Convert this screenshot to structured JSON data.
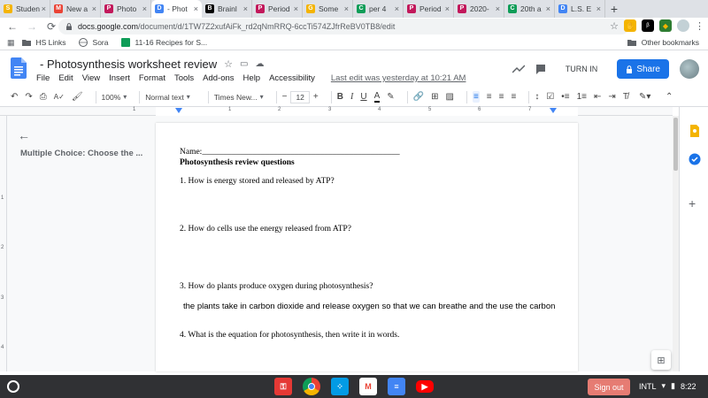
{
  "browser": {
    "tabs": [
      {
        "label": "Studen",
        "icon_color": "#f4b400",
        "icon_char": "S"
      },
      {
        "label": "New a",
        "icon_color": "#ea4335",
        "icon_char": "M"
      },
      {
        "label": "Photo",
        "icon_color": "#c2185b",
        "icon_char": "P"
      },
      {
        "label": "- Phot",
        "icon_color": "#4285f4",
        "icon_char": "D",
        "active": true
      },
      {
        "label": "Brainl",
        "icon_color": "#000000",
        "icon_char": "B"
      },
      {
        "label": "Period",
        "icon_color": "#c2185b",
        "icon_char": "P"
      },
      {
        "label": "Some",
        "icon_color": "#f4b400",
        "icon_char": "G"
      },
      {
        "label": "per 4",
        "icon_color": "#0f9d58",
        "icon_char": "C"
      },
      {
        "label": "Period",
        "icon_color": "#c2185b",
        "icon_char": "P"
      },
      {
        "label": "2020-",
        "icon_color": "#c2185b",
        "icon_char": "P"
      },
      {
        "label": "20th a",
        "icon_color": "#0f9d58",
        "icon_char": "C"
      },
      {
        "label": "L.S. E",
        "icon_color": "#4285f4",
        "icon_char": "D"
      }
    ],
    "new_tab": "+",
    "url_host": "docs.google.com",
    "url_path": "/document/d/1TW7Z2xufAiFk_rd2qNmRRQ-6ccTi574ZJfrReBV0TB8/edit",
    "bookmarks": [
      "HS Links",
      "Sora",
      "11-16 Recipes for S..."
    ],
    "other_bookmarks": "Other bookmarks"
  },
  "docs": {
    "title": "- Photosynthesis worksheet review",
    "menu": [
      "File",
      "Edit",
      "View",
      "Insert",
      "Format",
      "Tools",
      "Add-ons",
      "Help",
      "Accessibility"
    ],
    "last_edit": "Last edit was yesterday at 10:21 AM",
    "turn_in": "TURN IN",
    "share": "Share",
    "toolbar": {
      "zoom": "100%",
      "style": "Normal text",
      "font": "Times New...",
      "font_size": "12",
      "minus": "−",
      "plus": "+",
      "bold": "B",
      "italic": "I",
      "underline": "U",
      "text_color": "A"
    },
    "ruler_numbers": [
      "1",
      "1",
      "2",
      "3",
      "4",
      "5",
      "6",
      "7"
    ],
    "vruler_numbers": [
      "1",
      "2",
      "3",
      "4"
    ],
    "outline": {
      "heading": "Multiple Choice: Choose the ..."
    }
  },
  "document": {
    "name_line": "Name:_______________________________________________",
    "heading": "Photosynthesis review questions",
    "q1": "1.  How is energy stored and released by ATP?",
    "q2": "2.  How do cells use the energy released from ATP?",
    "q3": "3.  How do plants produce oxygen during photosynthesis?",
    "a3": "the plants take in carbon dioxide and release oxygen so that we can breathe and the use the carbon",
    "q4": "4.  What is the equation for photosynthesis, then write it in words."
  },
  "shelf": {
    "signout": "Sign out",
    "ime": "INTL",
    "time": "8:22"
  },
  "colors": {
    "accent": "#1a73e8",
    "shelf": "#303134",
    "signout": "#e67c73"
  }
}
